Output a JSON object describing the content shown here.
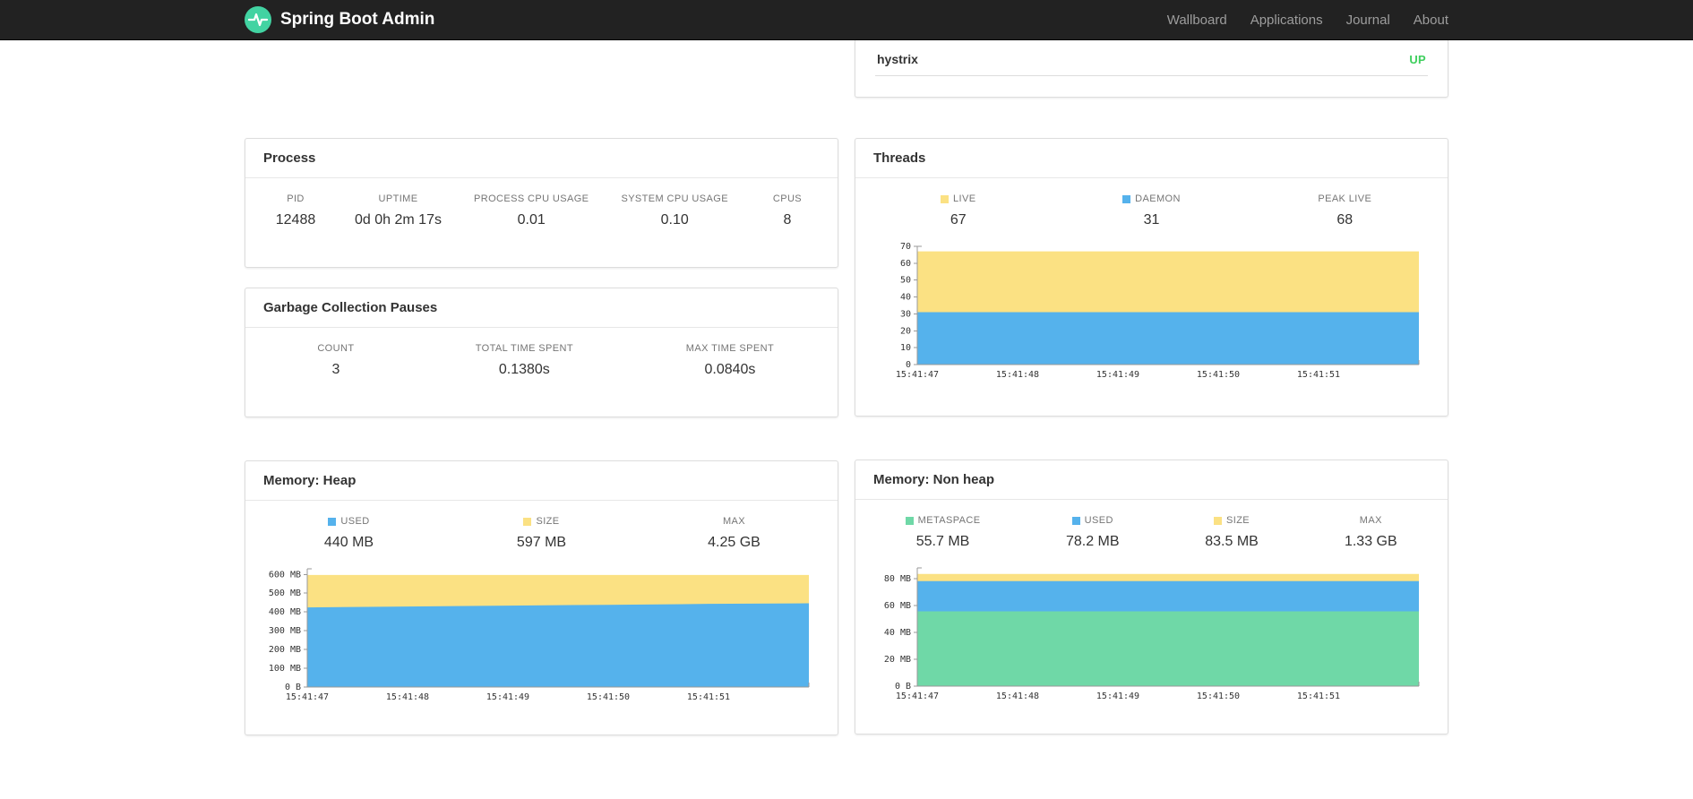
{
  "colors": {
    "navbar_bg": "#222222",
    "brand_green": "#42d3a2",
    "status_up_green": "#3fcf5e",
    "chart_yellow": "#fbe183",
    "chart_blue": "#55b2ec",
    "chart_green": "#6fd8a7"
  },
  "navbar": {
    "brand": "Spring Boot Admin",
    "items": [
      {
        "label": "Wallboard"
      },
      {
        "label": "Applications"
      },
      {
        "label": "Journal"
      },
      {
        "label": "About"
      }
    ]
  },
  "health": {
    "rows": [
      {
        "name": "hystrix",
        "status": "UP"
      }
    ]
  },
  "process": {
    "title": "Process",
    "metrics": [
      {
        "label": "PID",
        "value": "12488"
      },
      {
        "label": "UPTIME",
        "value": "0d 0h 2m 17s"
      },
      {
        "label": "PROCESS CPU USAGE",
        "value": "0.01"
      },
      {
        "label": "SYSTEM CPU USAGE",
        "value": "0.10"
      },
      {
        "label": "CPUS",
        "value": "8"
      }
    ]
  },
  "gc": {
    "title": "Garbage Collection Pauses",
    "metrics": [
      {
        "label": "COUNT",
        "value": "3"
      },
      {
        "label": "TOTAL TIME SPENT",
        "value": "0.1380s"
      },
      {
        "label": "MAX TIME SPENT",
        "value": "0.0840s"
      }
    ]
  },
  "threads": {
    "title": "Threads",
    "metrics": [
      {
        "label": "LIVE",
        "value": "67",
        "swatch": "#fbe183"
      },
      {
        "label": "DAEMON",
        "value": "31",
        "swatch": "#55b2ec"
      },
      {
        "label": "PEAK LIVE",
        "value": "68"
      }
    ]
  },
  "heap": {
    "title": "Memory: Heap",
    "metrics": [
      {
        "label": "USED",
        "value": "440 MB",
        "swatch": "#55b2ec"
      },
      {
        "label": "SIZE",
        "value": "597 MB",
        "swatch": "#fbe183"
      },
      {
        "label": "MAX",
        "value": "4.25 GB"
      }
    ]
  },
  "nonheap": {
    "title": "Memory: Non heap",
    "metrics": [
      {
        "label": "METASPACE",
        "value": "55.7 MB",
        "swatch": "#6fd8a7"
      },
      {
        "label": "USED",
        "value": "78.2 MB",
        "swatch": "#55b2ec"
      },
      {
        "label": "SIZE",
        "value": "83.5 MB",
        "swatch": "#fbe183"
      },
      {
        "label": "MAX",
        "value": "1.33 GB"
      }
    ]
  },
  "chart_data": [
    {
      "type": "area",
      "title": "Threads",
      "x": [
        "15:41:47",
        "15:41:48",
        "15:41:49",
        "15:41:50",
        "15:41:51"
      ],
      "ylim": [
        0,
        70
      ],
      "grid": false,
      "legend_position": "top",
      "y_ticks": [
        {
          "v": 0,
          "label": "0"
        },
        {
          "v": 10,
          "label": "10"
        },
        {
          "v": 20,
          "label": "20"
        },
        {
          "v": 30,
          "label": "30"
        },
        {
          "v": 40,
          "label": "40"
        },
        {
          "v": 50,
          "label": "50"
        },
        {
          "v": 60,
          "label": "60"
        },
        {
          "v": 70,
          "label": "70"
        }
      ],
      "series": [
        {
          "name": "live",
          "color": "#fbe183",
          "values": [
            67,
            67,
            67,
            67,
            67,
            67
          ]
        },
        {
          "name": "daemon",
          "color": "#55b2ec",
          "values": [
            31,
            31,
            31,
            31,
            31,
            31
          ]
        }
      ]
    },
    {
      "type": "area",
      "title": "Memory: Heap",
      "x": [
        "15:41:47",
        "15:41:48",
        "15:41:49",
        "15:41:50",
        "15:41:51"
      ],
      "ylim": [
        0,
        630
      ],
      "grid": false,
      "legend_position": "top",
      "y_ticks": [
        {
          "v": 0,
          "label": "0 B"
        },
        {
          "v": 100,
          "label": "100 MB"
        },
        {
          "v": 200,
          "label": "200 MB"
        },
        {
          "v": 300,
          "label": "300 MB"
        },
        {
          "v": 400,
          "label": "400 MB"
        },
        {
          "v": 500,
          "label": "500 MB"
        },
        {
          "v": 600,
          "label": "600 MB"
        }
      ],
      "series": [
        {
          "name": "size",
          "color": "#fbe183",
          "values": [
            597,
            597,
            597,
            597,
            597,
            597
          ]
        },
        {
          "name": "used",
          "color": "#55b2ec",
          "values": [
            424,
            429,
            434,
            438,
            443,
            446
          ]
        }
      ]
    },
    {
      "type": "area",
      "title": "Memory: Non heap",
      "x": [
        "15:41:47",
        "15:41:48",
        "15:41:49",
        "15:41:50",
        "15:41:51"
      ],
      "ylim": [
        0,
        88
      ],
      "grid": false,
      "legend_position": "top",
      "y_ticks": [
        {
          "v": 0,
          "label": "0 B"
        },
        {
          "v": 20,
          "label": "20 MB"
        },
        {
          "v": 40,
          "label": "40 MB"
        },
        {
          "v": 60,
          "label": "60 MB"
        },
        {
          "v": 80,
          "label": "80 MB"
        }
      ],
      "series": [
        {
          "name": "size",
          "color": "#fbe183",
          "values": [
            83.5,
            83.5,
            83.5,
            83.5,
            83.5,
            83.5
          ]
        },
        {
          "name": "used",
          "color": "#55b2ec",
          "values": [
            78.2,
            78.2,
            78.2,
            78.2,
            78.2,
            78.2
          ]
        },
        {
          "name": "metaspace",
          "color": "#6fd8a7",
          "values": [
            55.7,
            55.7,
            55.7,
            55.7,
            55.7,
            55.7
          ]
        }
      ]
    }
  ]
}
